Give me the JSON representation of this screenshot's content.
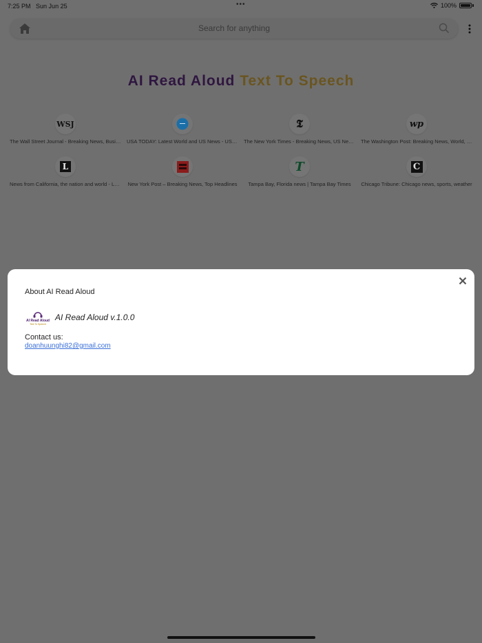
{
  "status_bar": {
    "time": "7:25 PM",
    "date": "Sun Jun 25",
    "battery": "100%",
    "dots": "•••"
  },
  "search": {
    "placeholder": "Search for anything"
  },
  "title": {
    "part1": "AI Read Aloud",
    "part2": "Text To Speech"
  },
  "shortcuts": [
    {
      "logo": "WSJ",
      "label": "The Wall Street Journal - Breaking News, Business, Financial & Economic News"
    },
    {
      "logo": "",
      "label": "USA TODAY: Latest World and US News - USATODAY.com"
    },
    {
      "logo": "𝕿",
      "label": "The New York Times - Breaking News, US News, World News"
    },
    {
      "logo": "wp",
      "label": "The Washington Post: Breaking News, World, US"
    },
    {
      "logo": "L",
      "label": "News from California, the nation and world - Los Angeles Times"
    },
    {
      "logo": "",
      "label": "New York Post – Breaking News, Top Headlines"
    },
    {
      "logo": "T",
      "label": "Tampa Bay, Florida news | Tampa Bay Times"
    },
    {
      "logo": "C",
      "label": "Chicago Tribune: Chicago news, sports, weather"
    }
  ],
  "dialog": {
    "title": "About AI Read Aloud",
    "app_version": "AI Read Aloud v.1.0.0",
    "logo_text_top": "AI Read Aloud",
    "logo_text_bottom": "Text To Speech",
    "contact_label": "Contact us:",
    "contact_email": "doanhuunghi82@gmail.com"
  }
}
